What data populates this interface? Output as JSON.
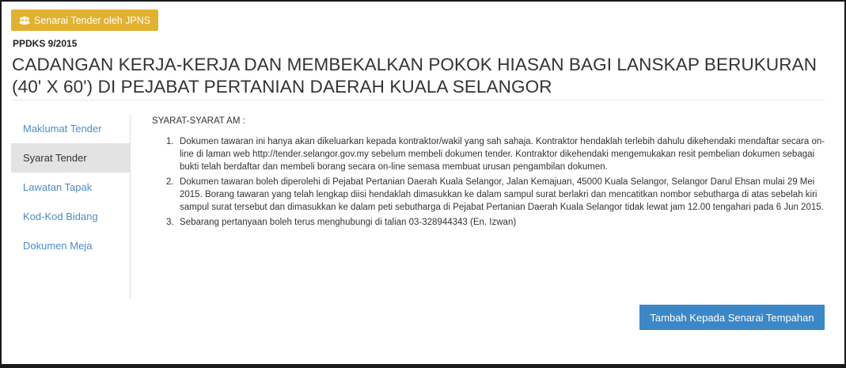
{
  "header": {
    "jpns_button_label": "Senarai Tender oleh JPNS",
    "tender_ref": "PPDKS 9/2015",
    "title": "CADANGAN KERJA-KERJA DAN MEMBEKALKAN POKOK HIASAN BAGI LANSKAP BERUKURAN (40' X 60') DI PEJABAT PERTANIAN DAERAH KUALA SELANGOR"
  },
  "sidebar": {
    "items": [
      {
        "label": "Maklumat Tender",
        "active": false
      },
      {
        "label": "Syarat Tender",
        "active": true
      },
      {
        "label": "Lawatan Tapak",
        "active": false
      },
      {
        "label": "Kod-Kod Bidang",
        "active": false
      },
      {
        "label": "Dokumen Meja",
        "active": false
      }
    ]
  },
  "content": {
    "heading": "SYARAT-SYARAT AM :",
    "terms": [
      {
        "num": "1.",
        "text": "Dokumen tawaran ini hanya akan dikeluarkan kepada kontraktor/wakil yang sah sahaja. Kontraktor hendaklah terlebih dahulu dikehendaki mendaftar secara on-line di laman web http://tender.selangor.gov.my sebelum membeli dokumen tender. Kontraktor dikehendaki mengemukakan resit pembelian dokumen sebagai bukti telah berdaftar dan membeli borang secara on-line semasa membuat urusan pengambilan dokumen."
      },
      {
        "num": "2.",
        "text": "Dokumen tawaran boleh diperolehi di Pejabat Pertanian Daerah Kuala Selangor, Jalan Kemajuan, 45000 Kuala Selangor, Selangor Darul Ehsan mulai 29 Mei 2015. Borang tawaran yang telah lengkap diisi hendaklah dimasukkan ke dalam sampul surat berlakri dan mencatitkan nombor sebutharga di atas sebelah kiri sampul surat tersebut dan dimasukkan ke dalam peti sebutharga di Pejabat Pertanian Daerah Kuala Selangor tidak lewat jam 12.00 tengahari pada 6 Jun 2015."
      },
      {
        "num": "3.",
        "text": "Sebarang pertanyaan boleh terus menghubungi di talian 03-328944343 (En. Izwan)"
      }
    ]
  },
  "actions": {
    "add_button_label": "Tambah Kepada Senarai Tempahan"
  },
  "colors": {
    "jpns_button": "#e2b12f",
    "primary_button": "#3c87c8",
    "link": "#4b8cc8",
    "active_nav_bg": "#e3e3e3"
  },
  "icons": {
    "jpns_button_icon": "users-icon"
  }
}
